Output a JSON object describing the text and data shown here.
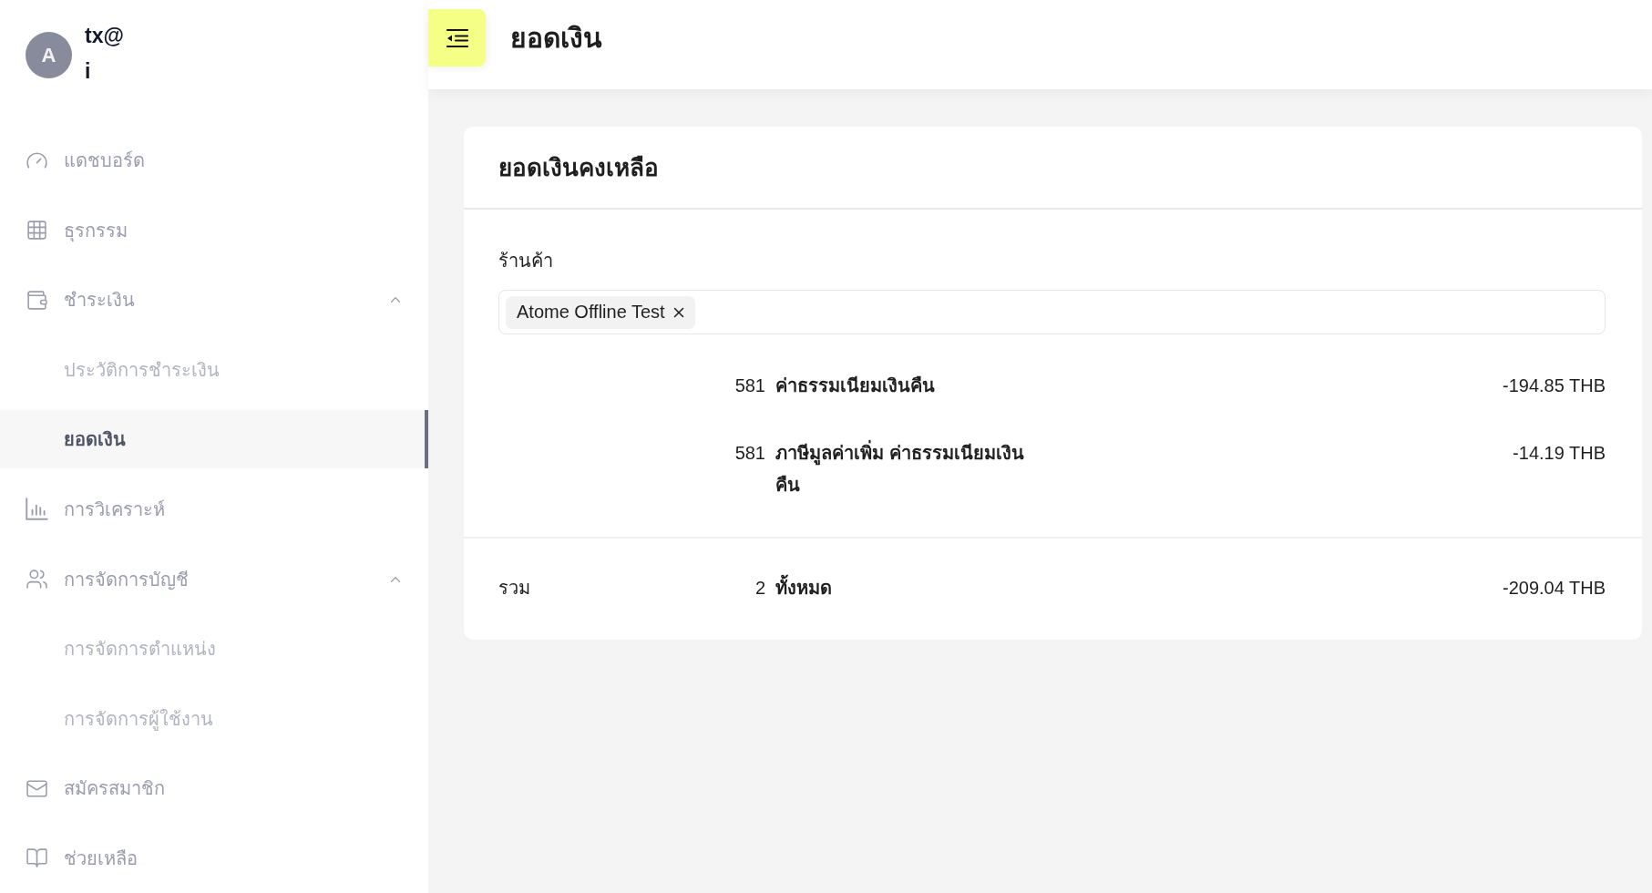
{
  "sidebar": {
    "user": {
      "initial": "A",
      "lines": [
        "tx@",
        "i"
      ]
    },
    "nav": [
      {
        "label": "แดชบอร์ด",
        "selected": false
      },
      {
        "label": "ธุรกรรม",
        "selected": false
      },
      {
        "label": "ชำระเงิน",
        "selected": false,
        "expanded": true,
        "children": [
          {
            "label": "ประวัติการชำระเงิน",
            "selected": false
          },
          {
            "label": "ยอดเงิน",
            "selected": true
          }
        ]
      },
      {
        "label": "การวิเคราะห์",
        "selected": false
      },
      {
        "label": "การจัดการบัญชี",
        "selected": false,
        "expanded": true,
        "children": [
          {
            "label": "การจัดการตำแหน่ง",
            "selected": false
          },
          {
            "label": "การจัดการผู้ใช้งาน",
            "selected": false
          }
        ]
      },
      {
        "label": "สมัครสมาชิก",
        "selected": false
      },
      {
        "label": "ช่วยเหลือ",
        "selected": false
      }
    ]
  },
  "header": {
    "title": "ยอดเงิน"
  },
  "card": {
    "title": "ยอดเงินคงเหลือ",
    "store_filter": {
      "label": "ร้านค้า",
      "chips": [
        "Atome Offline Test"
      ]
    },
    "rows": [
      {
        "count": "581",
        "description": "ค่าธรรมเนียมเงินคืน",
        "amount": "-194.85 THB"
      },
      {
        "count": "581",
        "description": "ภาษีมูลค่าเพิ่ม ค่าธรรมเนียมเงินคืน",
        "amount": "-14.19 THB"
      }
    ],
    "total": {
      "label": "รวม",
      "count": "2",
      "description": "ทั้งหมด",
      "amount": "-209.04 THB"
    }
  }
}
